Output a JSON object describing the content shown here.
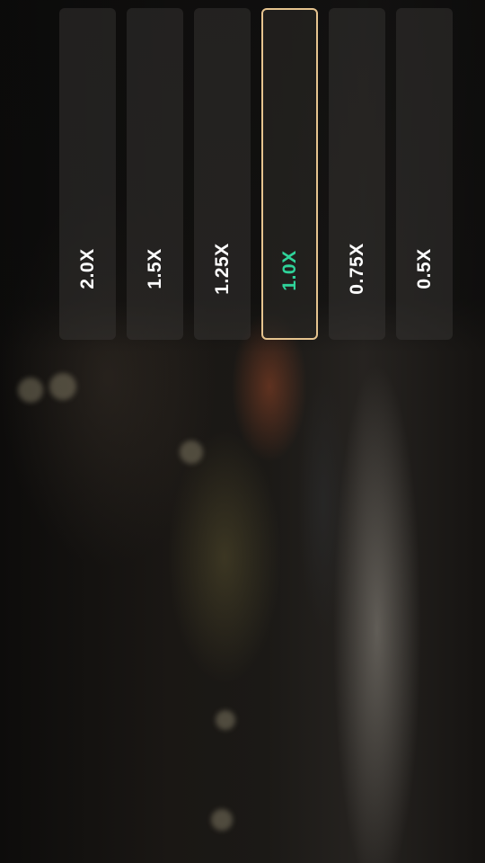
{
  "playback_speed": {
    "options": [
      {
        "label": "2.0X",
        "selected": false
      },
      {
        "label": "1.5X",
        "selected": false
      },
      {
        "label": "1.25X",
        "selected": false
      },
      {
        "label": "1.0X",
        "selected": true
      },
      {
        "label": "0.75X",
        "selected": false
      },
      {
        "label": "0.5X",
        "selected": false
      }
    ]
  },
  "colors": {
    "selected_border": "#e6c48f",
    "selected_text": "#2fd39a",
    "option_text": "#ffffff"
  }
}
